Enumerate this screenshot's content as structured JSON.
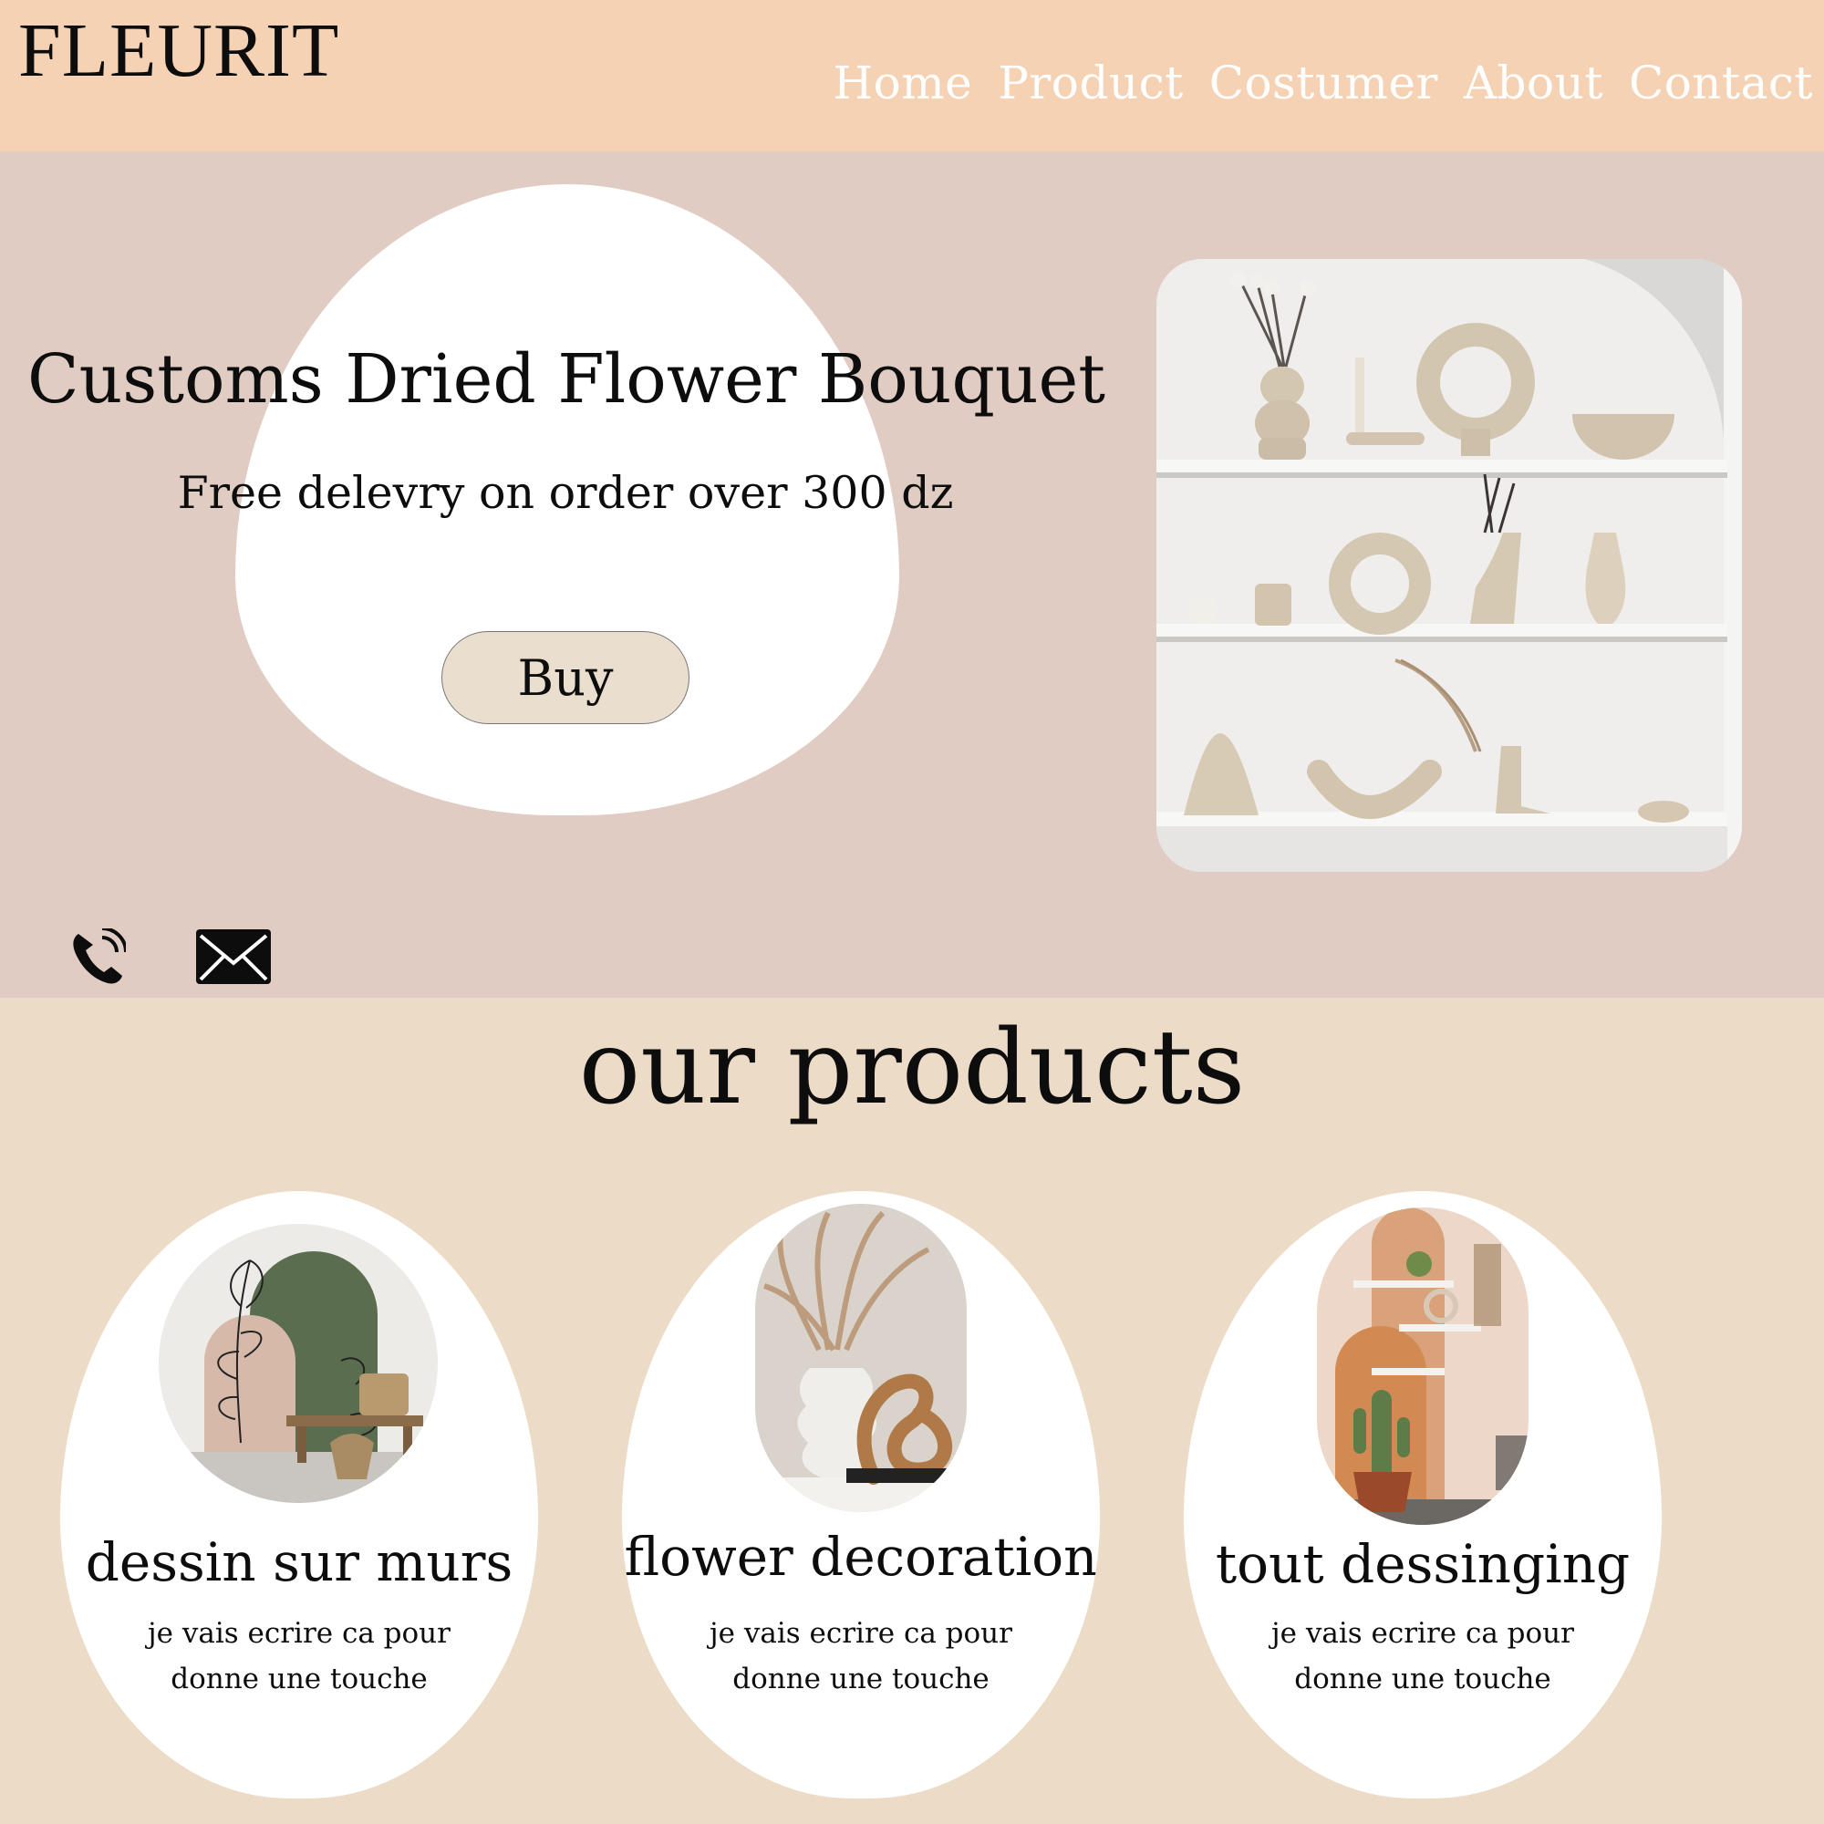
{
  "brand": {
    "logo": "FLEURIT"
  },
  "nav": {
    "items": [
      "Home",
      "Product",
      "Costumer",
      "About",
      "Contact"
    ]
  },
  "hero": {
    "title": "Customs Dried Flower Bouquet",
    "subtitle": "Free delevry on order over 300 dz",
    "buy_label": "Buy",
    "image": "shelf-with-ceramic-vases-photo"
  },
  "contact": {
    "phone_icon": "phone-icon",
    "mail_icon": "mail-icon"
  },
  "products": {
    "title": "our products",
    "cards": [
      {
        "title": "dessin sur murs",
        "desc_line1": "je vais ecrire ca pour",
        "desc_line2": "donne une touche",
        "image": "wall-painting-arches-photo"
      },
      {
        "title": "flower decoration",
        "desc_line1": "je vais ecrire ca pour",
        "desc_line2": "donne une touche",
        "image": "pampas-vase-decoration-photo"
      },
      {
        "title": "tout dessinging",
        "desc_line1": "je vais ecrire ca pour",
        "desc_line2": "donne une touche",
        "image": "orange-wall-cactus-photo"
      }
    ]
  },
  "colors": {
    "header_bg": "#f5d2b4",
    "hero_bg": "#e0ccc2",
    "products_bg": "#ecdcc7",
    "button_bg": "#eadfcf",
    "nav_text": "#ffffff"
  }
}
